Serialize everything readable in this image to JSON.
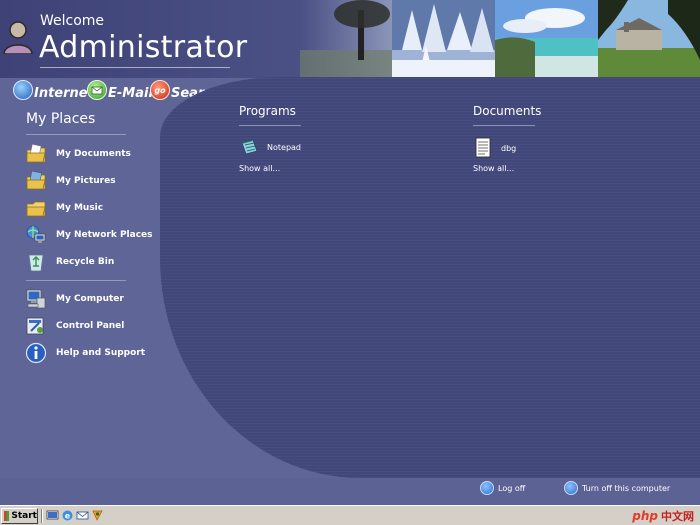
{
  "header": {
    "welcome": "Welcome",
    "user_name": "Administrator"
  },
  "quick_links": [
    {
      "label": "Internet",
      "icon": "globe-icon"
    },
    {
      "label": "E-Mail",
      "icon": "email-icon"
    },
    {
      "label": "Search",
      "icon": "search-go-icon"
    }
  ],
  "sidebar": {
    "title": "My Places",
    "items": [
      {
        "label": "My Documents",
        "icon": "my-documents-icon"
      },
      {
        "label": "My Pictures",
        "icon": "my-pictures-icon"
      },
      {
        "label": "My Music",
        "icon": "my-music-icon"
      },
      {
        "label": "My Network Places",
        "icon": "network-places-icon"
      },
      {
        "label": "Recycle Bin",
        "icon": "recycle-bin-icon"
      }
    ],
    "system_items": [
      {
        "label": "My Computer",
        "icon": "my-computer-icon"
      },
      {
        "label": "Control Panel",
        "icon": "control-panel-icon"
      },
      {
        "label": "Help and Support",
        "icon": "help-icon"
      }
    ]
  },
  "programs": {
    "title": "Programs",
    "items": [
      {
        "label": "Notepad",
        "icon": "notepad-icon"
      }
    ],
    "show_all": "Show all..."
  },
  "documents": {
    "title": "Documents",
    "items": [
      {
        "label": "dbg",
        "icon": "text-document-icon"
      }
    ],
    "show_all": "Show all..."
  },
  "footer": {
    "log_off": "Log off",
    "turn_off": "Turn off this computer"
  },
  "taskbar": {
    "start_label": "Start"
  },
  "watermark": {
    "latin": "php",
    "cjk": "中文网"
  },
  "colors": {
    "background": "#5f6596",
    "main_panel": "#41477a",
    "header": "#4a4f84",
    "taskbar": "#d4d0c8"
  }
}
